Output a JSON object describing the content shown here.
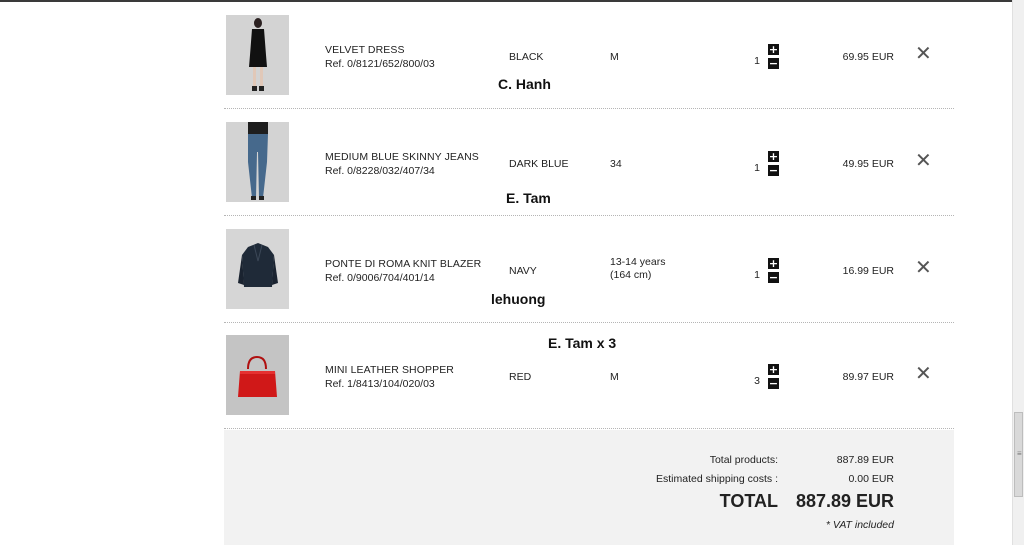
{
  "cart": {
    "items": [
      {
        "name": "VELVET DRESS",
        "ref": "Ref. 0/8121/652/800/03",
        "color": "BLACK",
        "size": "M",
        "qty": "1",
        "price": "69.95 EUR",
        "thumb_icon": "dress-image"
      },
      {
        "name": "MEDIUM BLUE SKINNY JEANS",
        "ref": "Ref. 0/8228/032/407/34",
        "color": "DARK BLUE",
        "size": "34",
        "qty": "1",
        "price": "49.95 EUR",
        "thumb_icon": "jeans-image"
      },
      {
        "name": "PONTE DI ROMA KNIT BLAZER",
        "ref": "Ref. 0/9006/704/401/14",
        "color": "NAVY",
        "size": "13-14 years\n(164 cm)",
        "qty": "1",
        "price": "16.99 EUR",
        "thumb_icon": "blazer-image"
      },
      {
        "name": "MINI LEATHER SHOPPER",
        "ref": "Ref. 1/8413/104/020/03",
        "color": "RED",
        "size": "M",
        "qty": "3",
        "price": "89.97 EUR",
        "thumb_icon": "handbag-image"
      }
    ],
    "stepper": {
      "plus": "+",
      "minus": "−"
    },
    "remove_symbol": "✕"
  },
  "notes": [
    "C. Hanh",
    "E. Tam",
    "lehuong",
    "E. Tam x 3"
  ],
  "summary": {
    "total_products_label": "Total products:",
    "total_products_value": "887.89 EUR",
    "shipping_label": "Estimated shipping costs :",
    "shipping_value": "0.00 EUR",
    "total_label": "TOTAL",
    "total_value": "887.89 EUR",
    "vat_note": "* VAT included"
  },
  "colors": {
    "summary_bg": "#f2f2f2",
    "text": "#222222",
    "bag_red": "#d01818"
  }
}
